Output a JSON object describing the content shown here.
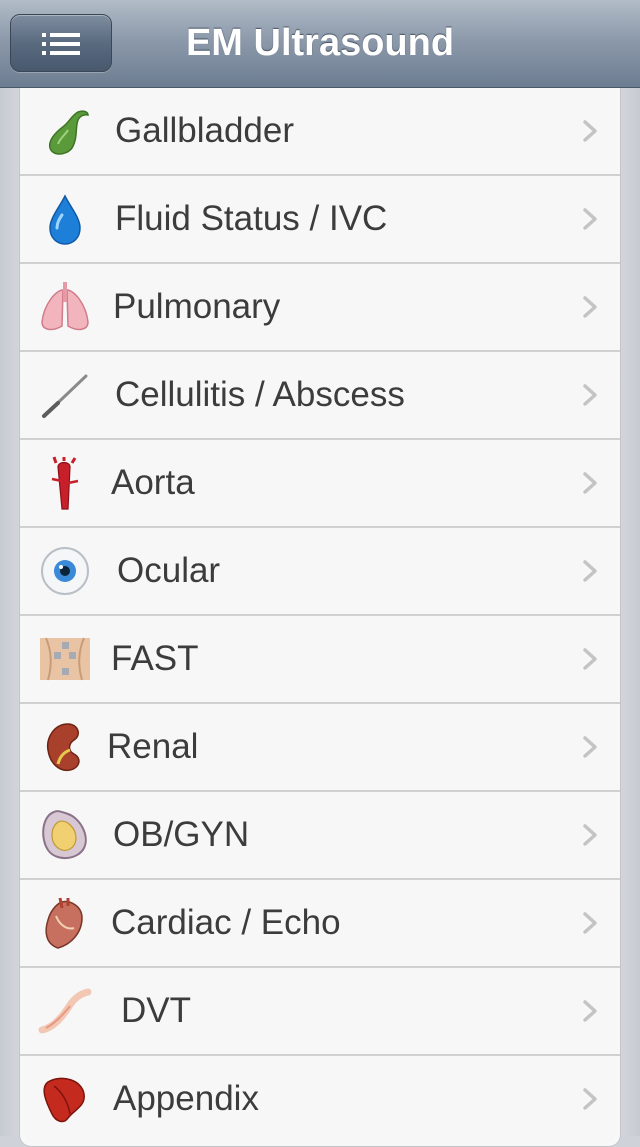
{
  "navbar": {
    "title": "EM Ultrasound",
    "menu_icon": "menu-icon"
  },
  "colors": {
    "navbar_top": "#b2bcc8",
    "navbar_bottom": "#6d7d91",
    "list_background": "#f7f7f7",
    "label_text": "#3c3c3c",
    "chevron": "#c4c4c6"
  },
  "items": [
    {
      "label": "Gallbladder",
      "icon": "gallbladder-icon"
    },
    {
      "label": "Fluid Status / IVC",
      "icon": "water-drop-icon"
    },
    {
      "label": "Pulmonary",
      "icon": "lungs-icon"
    },
    {
      "label": "Cellulitis / Abscess",
      "icon": "needle-icon"
    },
    {
      "label": "Aorta",
      "icon": "aorta-icon"
    },
    {
      "label": "Ocular",
      "icon": "eye-icon"
    },
    {
      "label": "FAST",
      "icon": "torso-icon"
    },
    {
      "label": "Renal",
      "icon": "kidney-icon"
    },
    {
      "label": "OB/GYN",
      "icon": "uterus-icon"
    },
    {
      "label": "Cardiac / Echo",
      "icon": "heart-icon"
    },
    {
      "label": "DVT",
      "icon": "leg-vein-icon"
    },
    {
      "label": "Appendix",
      "icon": "appendix-icon"
    }
  ]
}
